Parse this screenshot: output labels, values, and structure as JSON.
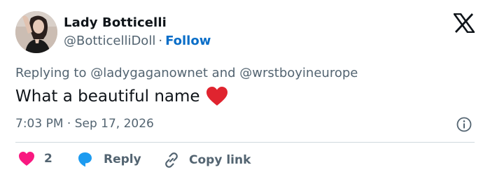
{
  "tweet": {
    "author": {
      "name": "Lady Botticelli",
      "handle": "@BotticelliDoll",
      "separator": "·",
      "follow_label": "Follow",
      "avatar_icon": "profile-photo"
    },
    "brand_icon": "x-logo",
    "replying": {
      "prefix": "Replying to",
      "mention1": "@ladygaganownet",
      "conjunction": "and",
      "mention2": "@wrstboyineurope"
    },
    "text": "What a beautiful name",
    "emoji": "red-heart",
    "timestamp": "7:03 PM · Sep 17, 2026",
    "info_icon": "info-icon",
    "actions": {
      "like_count": "2",
      "reply_label": "Reply",
      "copy_label": "Copy link"
    },
    "colors": {
      "like": "#f91880",
      "reply": "#1d9bf0",
      "follow": "#0a6ec8",
      "muted": "#536471",
      "emoji_heart": "#e0242f"
    }
  }
}
